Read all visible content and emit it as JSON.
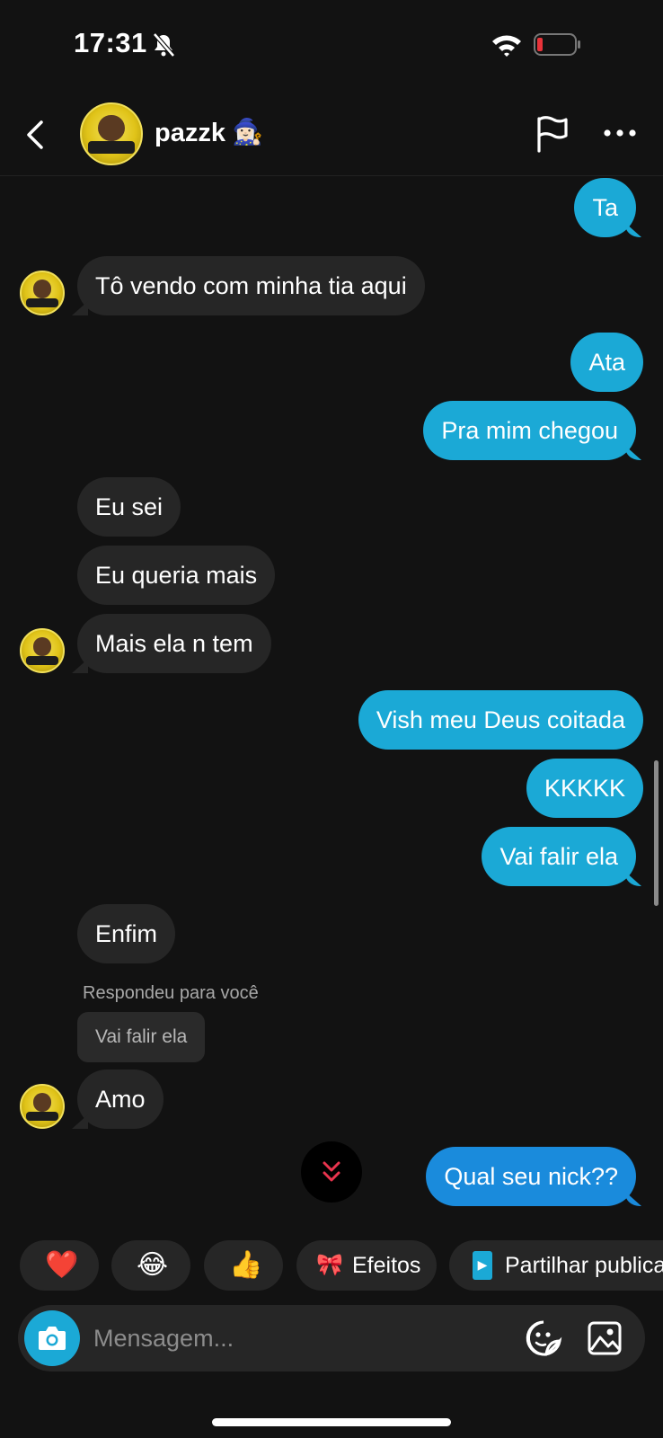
{
  "status_bar": {
    "time": "17:31"
  },
  "header": {
    "username": "pazzk",
    "name_emoji": "🧙🏻‍♀️"
  },
  "messages": [
    {
      "text": "Ta"
    },
    {
      "text": "Tô vendo com minha tia aqui"
    },
    {
      "text": "Ata"
    },
    {
      "text": "Pra mim chegou"
    },
    {
      "text": "Eu sei"
    },
    {
      "text": "Eu queria mais"
    },
    {
      "text": "Mais ela n tem"
    },
    {
      "text": "Vish meu Deus coitada"
    },
    {
      "text": "KKKKK"
    },
    {
      "text": "Vai falir ela"
    },
    {
      "text": "Enfim"
    },
    {
      "text": "Amo"
    },
    {
      "text": "Qual seu nick??"
    }
  ],
  "reply": {
    "label": "Respondeu para você",
    "quoted": "Vai falir ela"
  },
  "quick_replies": [
    {
      "emoji": "❤️"
    },
    {
      "emoji": "😂"
    },
    {
      "emoji": "👍"
    },
    {
      "emoji": "🎀",
      "label": "Efeitos"
    },
    {
      "emoji": "▶",
      "label": "Partilhar publica"
    }
  ],
  "composer": {
    "placeholder": "Mensagem..."
  },
  "colors": {
    "outgoing": "#1ba9d6",
    "outgoing_latest": "#1a8bdc",
    "incoming": "#262626",
    "background": "#121212"
  }
}
